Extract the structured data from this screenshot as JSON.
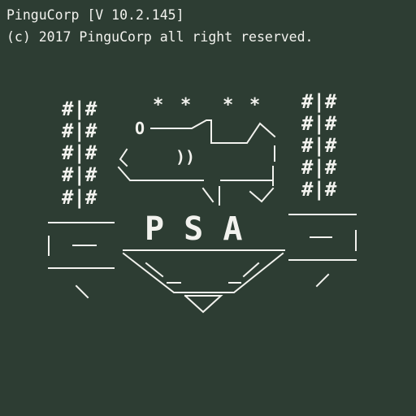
{
  "terminal": {
    "title_line": "PinguCorp [V 10.2.145]",
    "copyright_line": "(c) 2017 PinguCorp all right reserved.",
    "logo_text": "P S A",
    "background_color": "#2d3d33",
    "text_color": "#f2f2ee"
  }
}
